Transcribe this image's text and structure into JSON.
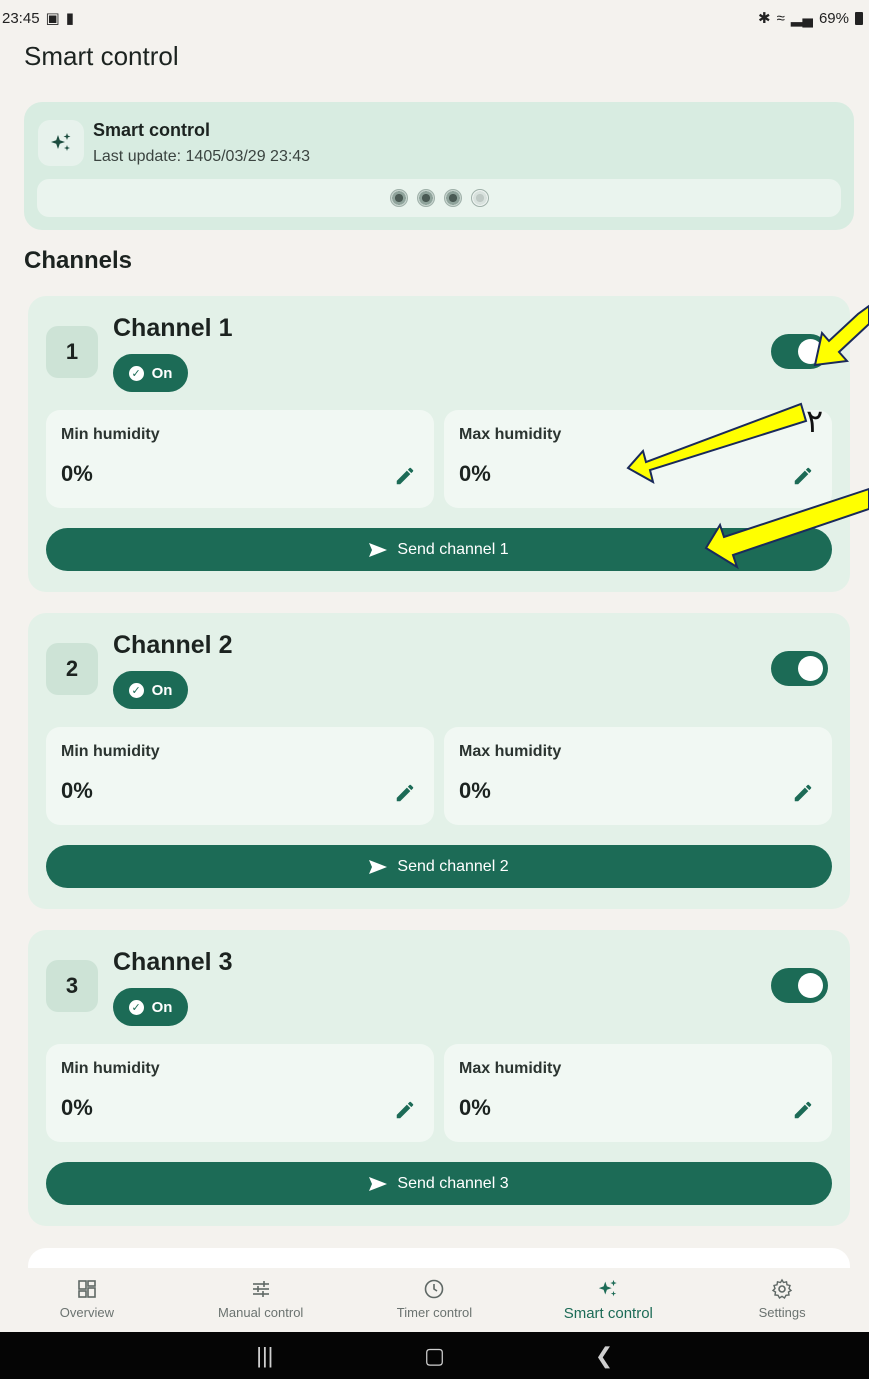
{
  "status_bar": {
    "time": "23:45",
    "battery": "69%",
    "icons": [
      "gallery-icon",
      "message-icon",
      "bluetooth-icon",
      "wifi-icon",
      "signal-icon",
      "battery-icon"
    ]
  },
  "page": {
    "title": "Smart control"
  },
  "header_card": {
    "title": "Smart control",
    "last_update": "Last update: 1405/03/29 23:43",
    "indicators": [
      "on",
      "on",
      "on",
      "off"
    ]
  },
  "section": {
    "title": "Channels"
  },
  "channels": [
    {
      "number": "1",
      "title": "Channel 1",
      "status": "On",
      "enabled": true,
      "min_label": "Min humidity",
      "min_value": "0%",
      "max_label": "Max humidity",
      "max_value": "0%",
      "send_label": "Send channel 1"
    },
    {
      "number": "2",
      "title": "Channel 2",
      "status": "On",
      "enabled": true,
      "min_label": "Min humidity",
      "min_value": "0%",
      "max_label": "Max humidity",
      "max_value": "0%",
      "send_label": "Send channel 2"
    },
    {
      "number": "3",
      "title": "Channel 3",
      "status": "On",
      "enabled": true,
      "min_label": "Min humidity",
      "min_value": "0%",
      "max_label": "Max humidity",
      "max_value": "0%",
      "send_label": "Send channel 3"
    }
  ],
  "annotations": {
    "digit": "٢"
  },
  "bottom_nav": {
    "items": [
      {
        "label": "Overview",
        "icon": "dashboard-icon"
      },
      {
        "label": "Manual control",
        "icon": "sliders-icon"
      },
      {
        "label": "Timer control",
        "icon": "clock-icon"
      },
      {
        "label": "Smart control",
        "icon": "sparkle-icon",
        "active": true
      },
      {
        "label": "Settings",
        "icon": "gear-icon"
      }
    ]
  },
  "colors": {
    "accent": "#1c6b56",
    "card_bg": "#e3f1e8",
    "header_bg": "#d8ece1",
    "page_bg": "#f4f2ee",
    "arrow_fill": "#ffff00"
  }
}
